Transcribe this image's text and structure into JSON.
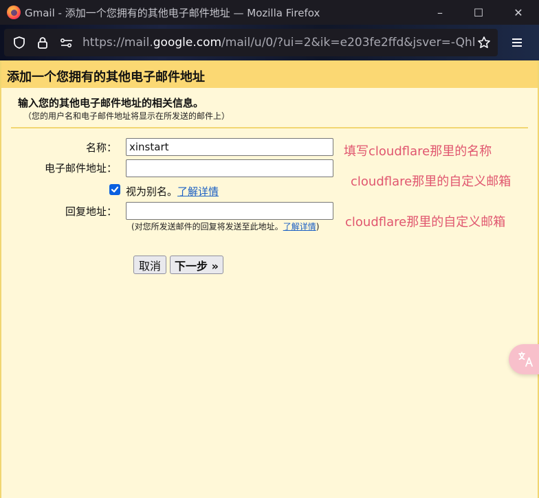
{
  "window": {
    "title": "Gmail - 添加一个您拥有的其他电子邮件地址 — Mozilla Firefox",
    "controls": {
      "minimize": "–",
      "maximize": "☐",
      "close": "✕"
    }
  },
  "urlbar": {
    "url_prefix": "https://mail.",
    "url_domain": "google.com",
    "url_suffix": "/mail/u/0/?ui=2&ik=e203fe2ffd&jsver=-Qhl"
  },
  "page": {
    "title": "添加一个您拥有的其他电子邮件地址",
    "section_title": "输入您的其他电子邮件地址的相关信息。",
    "section_subtitle": "（您的用户名和电子邮件地址将显示在所发送的邮件上）",
    "form": {
      "name_label": "名称：",
      "name_value": "xinstart",
      "email_label": "电子邮件地址：",
      "email_value": "",
      "alias_checked": true,
      "alias_label": "视为别名。",
      "alias_link": "了解详情",
      "reply_label": "回复地址：",
      "reply_value": "",
      "reply_note": "(对您所发送邮件的回复将发送至此地址。",
      "reply_note_link": "了解详情",
      "reply_note_end": ")"
    },
    "buttons": {
      "cancel": "取消",
      "next": "下一步 »"
    },
    "annotations": {
      "name": "填写cloudflare那里的名称",
      "email": "cloudflare那里的自定义邮箱",
      "reply": "cloudflare那里的自定义邮箱"
    }
  },
  "colors": {
    "header": "#fbd873",
    "page_bg": "#fff8d8",
    "annotation": "#e0566f",
    "link": "#1a5fc4",
    "checkbox": "#0b60e0"
  },
  "icons": [
    "firefox-logo-icon",
    "shield-icon",
    "lock-icon",
    "permissions-icon",
    "bookmark-star-icon",
    "hamburger-menu-icon",
    "translate-icon"
  ]
}
